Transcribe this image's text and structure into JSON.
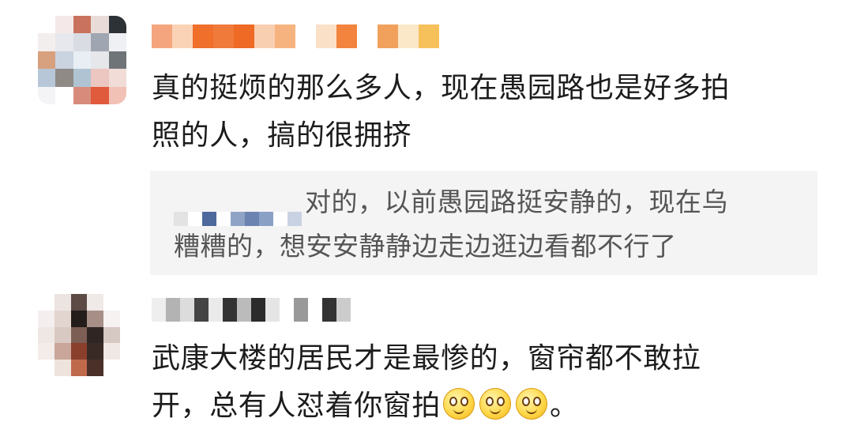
{
  "comments": [
    {
      "text_line1": "真的挺烦的那么多人，现在愚园路也是好多拍",
      "text_line2": "照的人，搞的很拥挤",
      "reply": {
        "text_line1": "对的，以前愚园路挺安静的，现在乌",
        "text_line2": "糟糟的，想安安静静边走边逛边看都不行了"
      }
    },
    {
      "text_line1": "武康大楼的居民才是最惨的，窗帘都不敢拉",
      "text_line2_before_emoji": "开，总有人怼着你窗拍",
      "emoji_name": "doge-emoji",
      "emoji_count": 3,
      "text_line2_after_emoji": "。"
    }
  ],
  "colors": {
    "avatar1": [
      "#ffffff",
      "#f4e9e8",
      "#c9735e",
      "#e9dcd8",
      "#2c3236",
      "#f3eeee",
      "#e6e8ee",
      "#d9dce3",
      "#9fa6b1",
      "#eef0f3",
      "#d7a07e",
      "#cad4e0",
      "#e8eef3",
      "#e5e7ea",
      "#6f7478",
      "#b7c7d7",
      "#8f8a86",
      "#b0c3d2",
      "#ecc6c0",
      "#f1dcd8",
      "#f4f4f6",
      "#ffffff",
      "#d88b7b",
      "#e05a3c",
      "#f2c1b5"
    ],
    "avatar2": [
      "#ffffff",
      "#ece4e1",
      "#5d4a45",
      "#efe9e7",
      "#ffffff",
      "#f4efee",
      "#e2d5d0",
      "#241c1a",
      "#a78f88",
      "#f6f2f1",
      "#efe7e4",
      "#d9c9c3",
      "#7d5e55",
      "#2f2624",
      "#d6c8c3",
      "#f3ece9",
      "#caa69a",
      "#8a3f2c",
      "#3a2a25",
      "#efe8e5",
      "#ffffff",
      "#efe3de",
      "#c06a4c",
      "#4b3029",
      "#ffffff"
    ],
    "username1": [
      "#f5a57d",
      "#fad3b6",
      "#ef6f2b",
      "#f07a3a",
      "#ee6a25",
      "#f9cfb2",
      "#f7b37f",
      "#ffffff",
      "#fbe0c8",
      "#f3843d",
      "#ffffff",
      "#f1a15c",
      "#fbe8c8",
      "#f6c05b"
    ],
    "username2": [
      "#eeeeee",
      "#b3b3b3",
      "#dcdcdc",
      "#444444",
      "#eaeaea",
      "#333333",
      "#bbbbbb",
      "#2b2b2b",
      "#e5e5e5",
      "#ffffff",
      "#999999",
      "#ffffff",
      "#333333",
      "#cccccc"
    ],
    "reply_user": [
      "#e3e3e3",
      "#ffffff",
      "#4e6a9c",
      "#ffffff",
      "#8ea3c6",
      "#6b83b0",
      "#8aa0c5",
      "#ffffff",
      "#c9d2e2"
    ]
  }
}
